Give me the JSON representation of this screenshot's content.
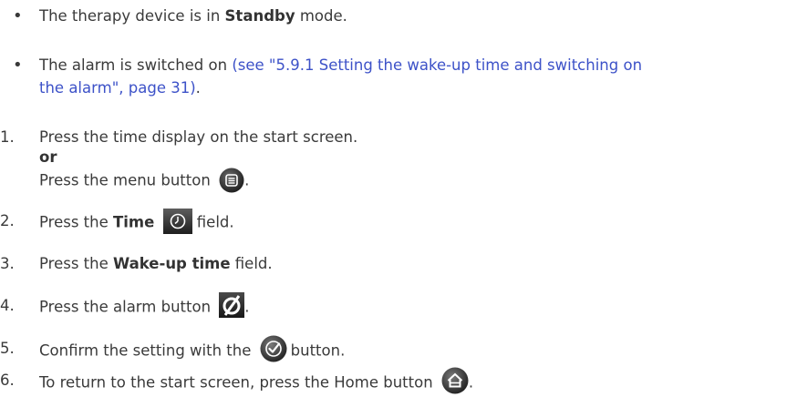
{
  "bullets": [
    {
      "pre": "The therapy device is in ",
      "bold": "Standby",
      "post": " mode."
    },
    {
      "pre": "The alarm is switched on ",
      "link_line1": "(see \"5.9.1 Setting the wake-up time and switching on",
      "link_line2": "the alarm\", page 31)",
      "post": "."
    }
  ],
  "steps": [
    {
      "num": "1.",
      "line1": "Press the time display on the start screen.",
      "or_label": "or",
      "line2_pre": "Press the menu button",
      "line2_post": ".",
      "icon": "menu-button-icon"
    },
    {
      "num": "2.",
      "pre": "Press the ",
      "bold": "Time",
      "post": " field.",
      "icon": "clock-icon"
    },
    {
      "num": "3.",
      "pre": "Press the ",
      "bold": "Wake-up time",
      "post": " field."
    },
    {
      "num": "4.",
      "pre": "Press the alarm button",
      "post": ".",
      "icon": "alarm-off-icon"
    },
    {
      "num": "5.",
      "pre": "Confirm the setting with the",
      "post": "button.",
      "icon": "confirm-checkmark-icon"
    },
    {
      "num": "6.",
      "pre": "To return to the start screen, press the Home button",
      "post": ".",
      "icon": "home-button-icon"
    }
  ],
  "colors": {
    "text": "#3a3a3a",
    "link": "#3d52c8",
    "icon_dark": "#2b2b2b"
  }
}
